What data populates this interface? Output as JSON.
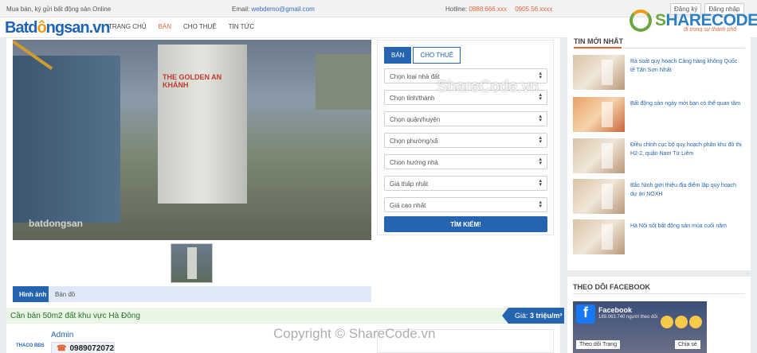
{
  "topbar": {
    "tagline": "Mua bán, ký gửi bất động sản Online",
    "email_label": "Email:",
    "email_value": "webdemo@gmail.com",
    "hotline_label": "Hotline:",
    "hotline_1": "0888.666.xxx",
    "hotline_2": "0905.56.xxxx",
    "register": "Đăng ký",
    "login": "Đăng nhập"
  },
  "header": {
    "logo_a": "Batd",
    "logo_dot": "ô",
    "logo_b": "ngsan.vn",
    "nav": [
      "TRANG CHỦ",
      "BÁN",
      "CHO THUÊ",
      "TIN TỨC"
    ]
  },
  "sharecode": {
    "logo_a": "S",
    "logo_b": "HARECODE.vn",
    "sub": "đi trong sự thành phố"
  },
  "listing": {
    "photo_sign": "THE GOLDEN AN KHÁNH",
    "photo_watermark": "batdongsan",
    "tabs": [
      "Hình ảnh",
      "Bản đồ"
    ],
    "title": "Cần bán 50m2 đất khu vực Hà Đông",
    "price_label": "Giá:",
    "price_value": "3 triệu/m²",
    "agent_name": "Admin",
    "agent_phone": "0989072072",
    "agent_logo": "THACO BĐS"
  },
  "search": {
    "tabs": [
      "BÁN",
      "CHO THUÊ"
    ],
    "fields": [
      "Chọn loại nhà đất",
      "Chọn tỉnh/thành",
      "Chọn quận/huyện",
      "Chọn phường/xã",
      "Chọn hướng nhà",
      "Giá thấp nhất",
      "Giá cao nhất"
    ],
    "button": "TÌM KIẾM!"
  },
  "sidebar": {
    "news_title": "TIN MỚI NHẤT",
    "news": [
      "Rà soát quy hoạch Cảng hàng không Quốc tế Tân Sơn Nhất",
      "Bất động sản ngày mới bạn có thể quan tâm",
      "Điều chỉnh cục bộ quy hoạch phân khu đô thị H2-2, quận Nam Từ Liêm",
      "Bắc Ninh giới thiệu địa điểm lập quy hoạch dự án NOXH",
      "Hà Nội sốt bất động sản mùa cuối năm"
    ],
    "fb_title": "THEO DÕI FACEBOOK",
    "fb_name": "Facebook",
    "fb_count": "189.063.740 người theo dõi",
    "fb_follow": "Theo dõi Trang",
    "fb_share": "Chia sẻ"
  },
  "watermarks": {
    "center": "ShareCode.vn",
    "bottom": "Copyright © ShareCode.vn"
  }
}
